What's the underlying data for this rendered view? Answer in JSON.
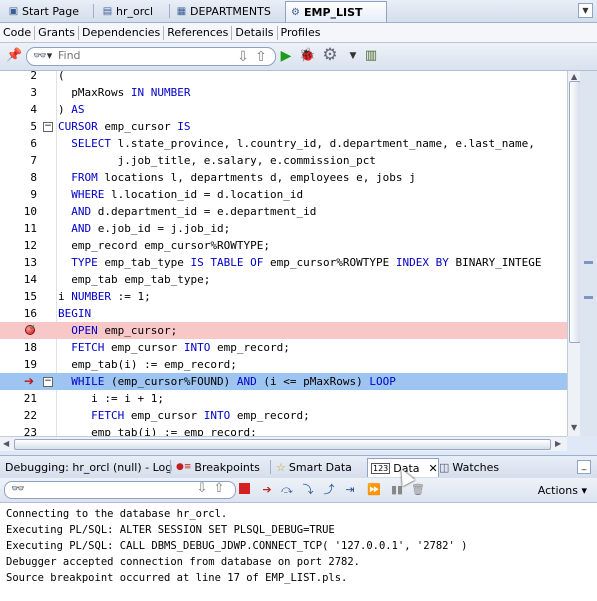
{
  "doc_tabs": [
    {
      "label": "Start Page",
      "icon": "start-page-icon"
    },
    {
      "label": "hr_orcl",
      "icon": "db-connection-icon"
    },
    {
      "label": "DEPARTMENTS",
      "icon": "table-icon"
    },
    {
      "label": "EMP_LIST",
      "icon": "procedure-icon",
      "active": true
    }
  ],
  "sub_tabs": [
    "Code",
    "Grants",
    "Dependencies",
    "References",
    "Details",
    "Profiles"
  ],
  "editor_toolbar": {
    "find_placeholder": "Find"
  },
  "code_lines": [
    {
      "num": "2",
      "text": "("
    },
    {
      "num": "3",
      "text": "  pMaxRows IN NUMBER"
    },
    {
      "num": "4",
      "text": ") AS"
    },
    {
      "num": "5",
      "text": "CURSOR emp_cursor IS"
    },
    {
      "num": "6",
      "text": "  SELECT l.state_province, l.country_id, d.department_name, e.last_name,"
    },
    {
      "num": "7",
      "text": "         j.job_title, e.salary, e.commission_pct"
    },
    {
      "num": "8",
      "text": "  FROM locations l, departments d, employees e, jobs j"
    },
    {
      "num": "9",
      "text": "  WHERE l.location_id = d.location_id"
    },
    {
      "num": "10",
      "text": "  AND d.department_id = e.department_id"
    },
    {
      "num": "11",
      "text": "  AND e.job_id = j.job_id;"
    },
    {
      "num": "12",
      "text": "  emp_record emp_cursor%ROWTYPE;"
    },
    {
      "num": "13",
      "text": "  TYPE emp_tab_type IS TABLE OF emp_cursor%ROWTYPE INDEX BY BINARY_INTEGE"
    },
    {
      "num": "14",
      "text": "  emp_tab emp_tab_type;"
    },
    {
      "num": "15",
      "text": "i NUMBER := 1;"
    },
    {
      "num": "16",
      "text": "BEGIN"
    },
    {
      "num": "",
      "text": "  OPEN emp_cursor;"
    },
    {
      "num": "18",
      "text": "  FETCH emp_cursor INTO emp_record;"
    },
    {
      "num": "19",
      "text": "  emp_tab(i) := emp_record;"
    },
    {
      "num": "",
      "text": "  WHILE (emp_cursor%FOUND) AND (i <= pMaxRows) LOOP"
    },
    {
      "num": "21",
      "text": "     i := i + 1;"
    },
    {
      "num": "22",
      "text": "     FETCH emp_cursor INTO emp_record;"
    },
    {
      "num": "23",
      "text": "     emp_tab(i) := emp_record;"
    }
  ],
  "debug_tabs": [
    {
      "label": "Debugging: hr_orcl (null) - Log"
    },
    {
      "label": "Breakpoints",
      "icon": "breakpoints-icon"
    },
    {
      "label": "Smart Data",
      "icon": "smart-data-icon"
    },
    {
      "label": "Data",
      "icon": "data-icon",
      "active": true
    },
    {
      "label": "Watches",
      "icon": "watches-icon"
    }
  ],
  "debug_toolbar": {
    "actions_label": "Actions"
  },
  "log_lines": [
    "Connecting to the database hr_orcl.",
    "Executing PL/SQL: ALTER SESSION SET PLSQL_DEBUG=TRUE",
    "Executing PL/SQL: CALL DBMS_DEBUG_JDWP.CONNECT_TCP( '127.0.0.1', '2782' )",
    "Debugger accepted connection from database on port 2782.",
    "Source breakpoint occurred at line 17 of EMP_LIST.pls."
  ],
  "colors": {
    "keyword": "#0000c8",
    "breakpoint_line": "#f8c8c8",
    "execution_line": "#9ec5f1"
  }
}
